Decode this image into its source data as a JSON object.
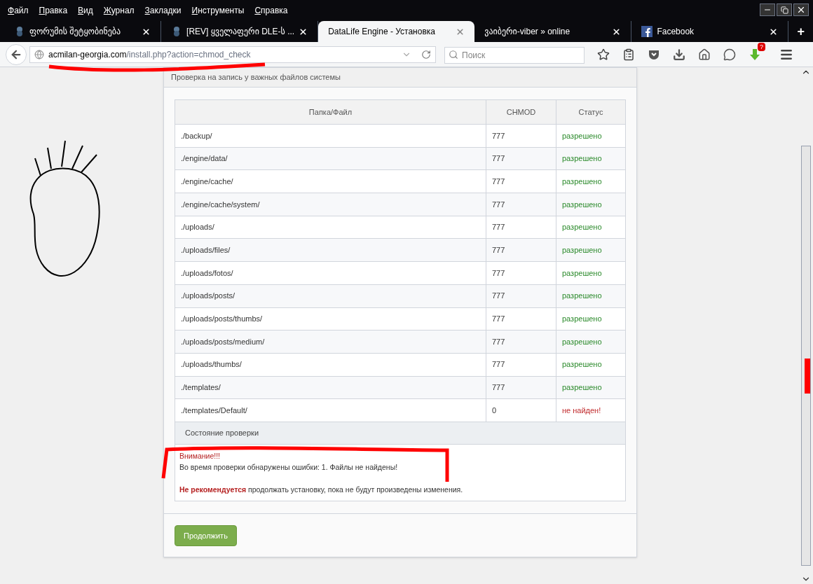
{
  "menu": [
    "Файл",
    "Правка",
    "Вид",
    "Журнал",
    "Закладки",
    "Инструменты",
    "Справка"
  ],
  "tabs": [
    {
      "title": "ფორუმის შეტყობინება",
      "kind": "forum",
      "selected": false
    },
    {
      "title": "[REV] ყველაფერი DLE-ს ...",
      "kind": "forum",
      "selected": false
    },
    {
      "title": "DataLife Engine - Установка",
      "kind": "plain",
      "selected": true
    },
    {
      "title": "ვაიბერი-viber » online",
      "kind": "plain",
      "selected": false
    },
    {
      "title": "Facebook",
      "kind": "social",
      "selected": false
    }
  ],
  "new_tab": "+",
  "address": {
    "domain": "acmilan-georgia.com",
    "path": "/install.php?action=chmod_check"
  },
  "search": {
    "placeholder": "Поиск"
  },
  "downloads_badge": "?",
  "panel": {
    "title": "Проверка на запись у важных файлов системы",
    "columns": [
      "Папка/Файл",
      "CHMOD",
      "Статус"
    ],
    "rows": [
      {
        "path": "./backup/",
        "chmod": "777",
        "status": "разрешено",
        "kind": "ok"
      },
      {
        "path": "./engine/data/",
        "chmod": "777",
        "status": "разрешено",
        "kind": "ok"
      },
      {
        "path": "./engine/cache/",
        "chmod": "777",
        "status": "разрешено",
        "kind": "ok"
      },
      {
        "path": "./engine/cache/system/",
        "chmod": "777",
        "status": "разрешено",
        "kind": "ok"
      },
      {
        "path": "./uploads/",
        "chmod": "777",
        "status": "разрешено",
        "kind": "ok"
      },
      {
        "path": "./uploads/files/",
        "chmod": "777",
        "status": "разрешено",
        "kind": "ok"
      },
      {
        "path": "./uploads/fotos/",
        "chmod": "777",
        "status": "разрешено",
        "kind": "ok"
      },
      {
        "path": "./uploads/posts/",
        "chmod": "777",
        "status": "разрешено",
        "kind": "ok"
      },
      {
        "path": "./uploads/posts/thumbs/",
        "chmod": "777",
        "status": "разрешено",
        "kind": "ok"
      },
      {
        "path": "./uploads/posts/medium/",
        "chmod": "777",
        "status": "разрешено",
        "kind": "ok"
      },
      {
        "path": "./uploads/thumbs/",
        "chmod": "777",
        "status": "разрешено",
        "kind": "ok"
      },
      {
        "path": "./templates/",
        "chmod": "777",
        "status": "разрешено",
        "kind": "ok"
      },
      {
        "path": "./templates/Default/",
        "chmod": "0",
        "status": "не найден!",
        "kind": "error"
      }
    ],
    "state_heading": "Состояние проверки",
    "warning_title": "Внимание!!!",
    "warning_text": "Во время проверки обнаружены ошибки: 1. Файлы не найдены!",
    "recommend": "**Не рекомендуется** продолжать установку, пока не будут произведены изменения.",
    "continue_button": "Продолжить"
  }
}
